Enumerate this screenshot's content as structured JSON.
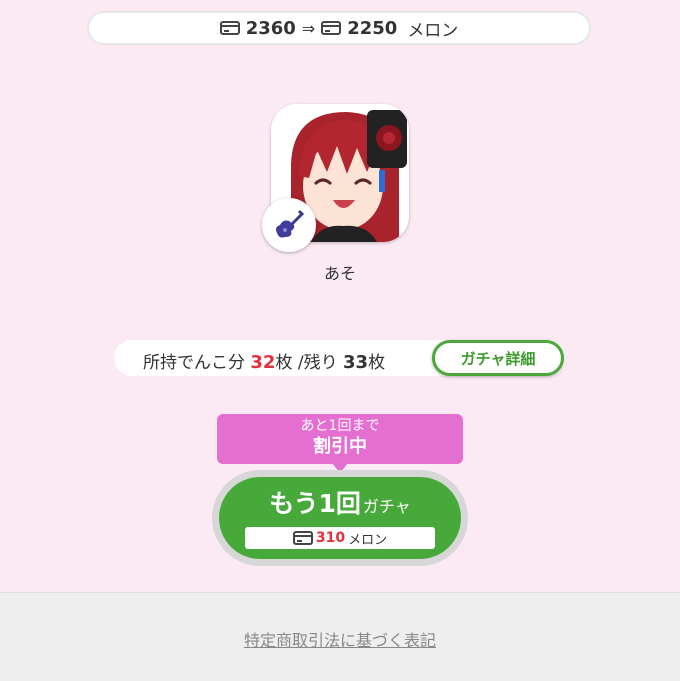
{
  "header": {
    "from_amount": "2360",
    "arrow": "⇒",
    "to_amount": "2250",
    "unit": "メロン"
  },
  "profile": {
    "name": "あそ",
    "avatar_icon": "character-portrait-icon",
    "badge_icon": "guitar-icon"
  },
  "info": {
    "prefix": "所持でんこ分",
    "owned_count": "32",
    "owned_unit": "枚",
    "separator": " /残り",
    "remaining_count": "33",
    "remaining_unit": "枚",
    "detail_button": "ガチャ詳細"
  },
  "promo": {
    "line1": "あと1回まで",
    "line2": "割引中"
  },
  "gacha": {
    "title_big": "もう1回",
    "title_small": "ガチャ",
    "price": "310",
    "price_unit": "メロン"
  },
  "footer": {
    "link": "特定商取引法に基づく表記"
  },
  "colors": {
    "background": "#fbeaf4",
    "accent_green": "#48a93b",
    "promo_pink": "#e56fd1",
    "highlight_red": "#e5313a"
  }
}
